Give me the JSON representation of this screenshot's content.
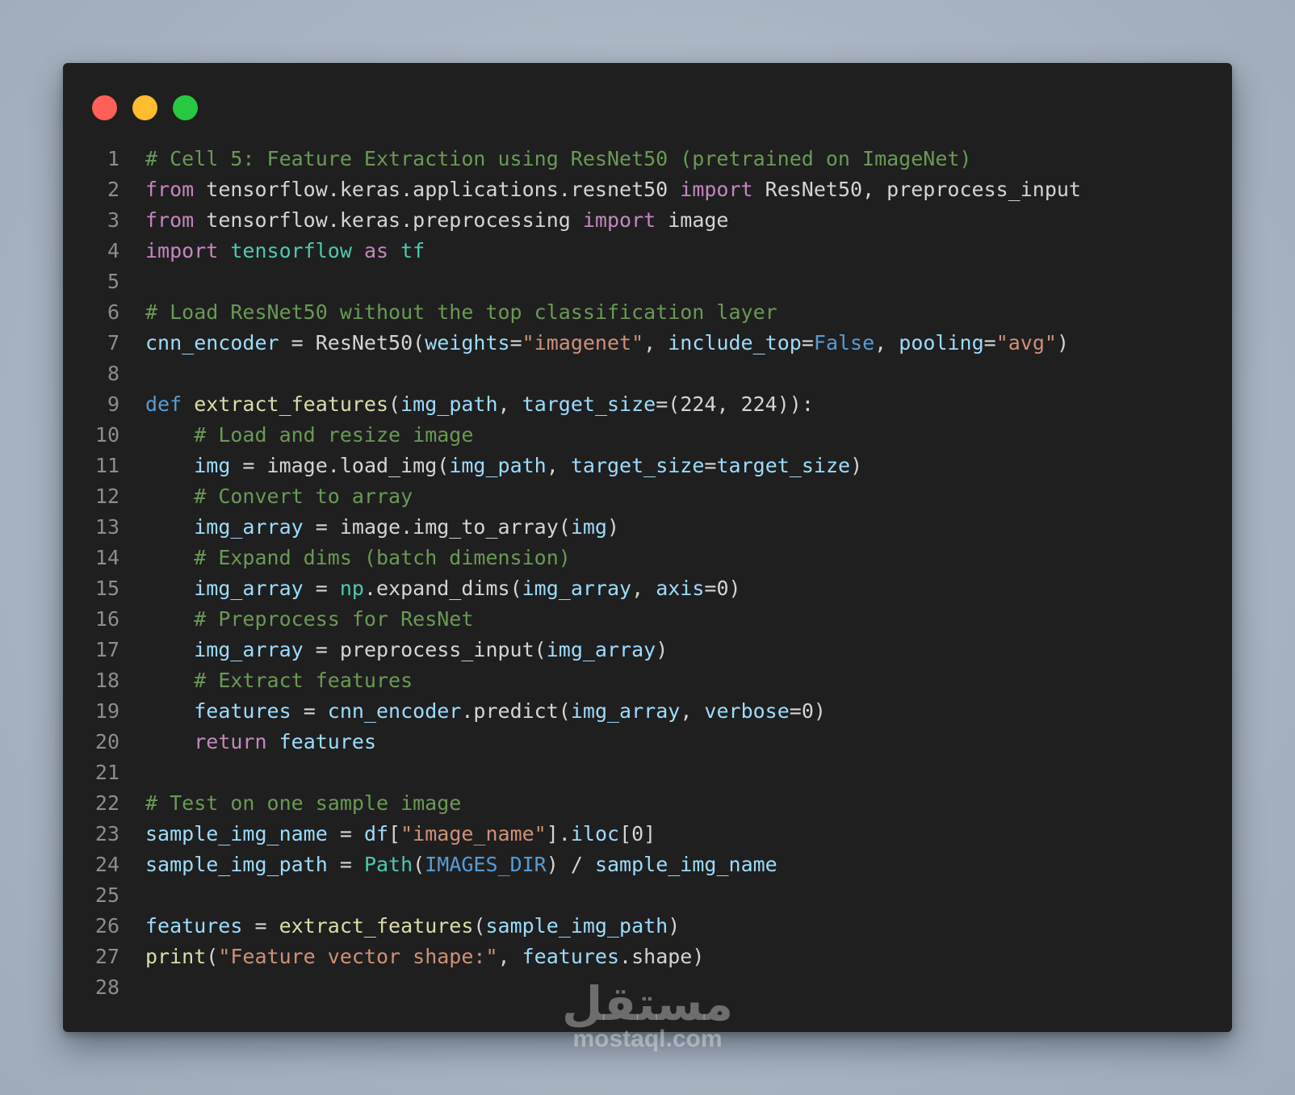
{
  "window": {
    "controls": [
      {
        "name": "close",
        "color": "#fe5f57"
      },
      {
        "name": "minimize",
        "color": "#febc2e"
      },
      {
        "name": "maximize",
        "color": "#28c840"
      }
    ]
  },
  "code": {
    "language": "python",
    "lines": [
      {
        "n": "1",
        "tokens": [
          {
            "t": "# Cell 5: Feature Extraction using ResNet50 (pretrained on ImageNet)",
            "c": "comment"
          }
        ]
      },
      {
        "n": "2",
        "tokens": [
          {
            "t": "from",
            "c": "kw"
          },
          {
            "t": " tensorflow.keras.applications.resnet50 ",
            "c": "plain"
          },
          {
            "t": "import",
            "c": "kw"
          },
          {
            "t": " ResNet50, preprocess_input",
            "c": "plain"
          }
        ]
      },
      {
        "n": "3",
        "tokens": [
          {
            "t": "from",
            "c": "kw"
          },
          {
            "t": " tensorflow.keras.preprocessing ",
            "c": "plain"
          },
          {
            "t": "import",
            "c": "kw"
          },
          {
            "t": " image",
            "c": "plain"
          }
        ]
      },
      {
        "n": "4",
        "tokens": [
          {
            "t": "import",
            "c": "kw"
          },
          {
            "t": " ",
            "c": "plain"
          },
          {
            "t": "tensorflow",
            "c": "mod"
          },
          {
            "t": " ",
            "c": "plain"
          },
          {
            "t": "as",
            "c": "kw"
          },
          {
            "t": " ",
            "c": "plain"
          },
          {
            "t": "tf",
            "c": "mod"
          }
        ]
      },
      {
        "n": "5",
        "tokens": []
      },
      {
        "n": "6",
        "tokens": [
          {
            "t": "# Load ResNet50 without the top classification layer",
            "c": "comment"
          }
        ]
      },
      {
        "n": "7",
        "tokens": [
          {
            "t": "cnn_encoder",
            "c": "var"
          },
          {
            "t": " = ResNet50(",
            "c": "plain"
          },
          {
            "t": "weights",
            "c": "var"
          },
          {
            "t": "=",
            "c": "plain"
          },
          {
            "t": "\"imagenet\"",
            "c": "str"
          },
          {
            "t": ", ",
            "c": "plain"
          },
          {
            "t": "include_top",
            "c": "var"
          },
          {
            "t": "=",
            "c": "plain"
          },
          {
            "t": "False",
            "c": "const"
          },
          {
            "t": ", ",
            "c": "plain"
          },
          {
            "t": "pooling",
            "c": "var"
          },
          {
            "t": "=",
            "c": "plain"
          },
          {
            "t": "\"avg\"",
            "c": "str"
          },
          {
            "t": ")",
            "c": "plain"
          }
        ]
      },
      {
        "n": "8",
        "tokens": []
      },
      {
        "n": "9",
        "tokens": [
          {
            "t": "def",
            "c": "def"
          },
          {
            "t": " ",
            "c": "plain"
          },
          {
            "t": "extract_features",
            "c": "fn"
          },
          {
            "t": "(",
            "c": "plain"
          },
          {
            "t": "img_path",
            "c": "var"
          },
          {
            "t": ", ",
            "c": "plain"
          },
          {
            "t": "target_size",
            "c": "var"
          },
          {
            "t": "=(224, 224)):",
            "c": "plain"
          }
        ]
      },
      {
        "n": "10",
        "tokens": [
          {
            "t": "    ",
            "c": "plain"
          },
          {
            "t": "# Load and resize image",
            "c": "comment"
          }
        ]
      },
      {
        "n": "11",
        "tokens": [
          {
            "t": "    ",
            "c": "plain"
          },
          {
            "t": "img",
            "c": "var"
          },
          {
            "t": " = image.load_img(",
            "c": "plain"
          },
          {
            "t": "img_path",
            "c": "var"
          },
          {
            "t": ", ",
            "c": "plain"
          },
          {
            "t": "target_size",
            "c": "var"
          },
          {
            "t": "=",
            "c": "plain"
          },
          {
            "t": "target_size",
            "c": "var"
          },
          {
            "t": ")",
            "c": "plain"
          }
        ]
      },
      {
        "n": "12",
        "tokens": [
          {
            "t": "    ",
            "c": "plain"
          },
          {
            "t": "# Convert to array",
            "c": "comment"
          }
        ]
      },
      {
        "n": "13",
        "tokens": [
          {
            "t": "    ",
            "c": "plain"
          },
          {
            "t": "img_array",
            "c": "var"
          },
          {
            "t": " = image.img_to_array(",
            "c": "plain"
          },
          {
            "t": "img",
            "c": "var"
          },
          {
            "t": ")",
            "c": "plain"
          }
        ]
      },
      {
        "n": "14",
        "tokens": [
          {
            "t": "    ",
            "c": "plain"
          },
          {
            "t": "# Expand dims (batch dimension)",
            "c": "comment"
          }
        ]
      },
      {
        "n": "15",
        "tokens": [
          {
            "t": "    ",
            "c": "plain"
          },
          {
            "t": "img_array",
            "c": "var"
          },
          {
            "t": " = ",
            "c": "plain"
          },
          {
            "t": "np",
            "c": "mod"
          },
          {
            "t": ".expand_dims(",
            "c": "plain"
          },
          {
            "t": "img_array",
            "c": "var"
          },
          {
            "t": ", ",
            "c": "plain"
          },
          {
            "t": "axis",
            "c": "var"
          },
          {
            "t": "=0)",
            "c": "plain"
          }
        ]
      },
      {
        "n": "16",
        "tokens": [
          {
            "t": "    ",
            "c": "plain"
          },
          {
            "t": "# Preprocess for ResNet",
            "c": "comment"
          }
        ]
      },
      {
        "n": "17",
        "tokens": [
          {
            "t": "    ",
            "c": "plain"
          },
          {
            "t": "img_array",
            "c": "var"
          },
          {
            "t": " = preprocess_input(",
            "c": "plain"
          },
          {
            "t": "img_array",
            "c": "var"
          },
          {
            "t": ")",
            "c": "plain"
          }
        ]
      },
      {
        "n": "18",
        "tokens": [
          {
            "t": "    ",
            "c": "plain"
          },
          {
            "t": "# Extract features",
            "c": "comment"
          }
        ]
      },
      {
        "n": "19",
        "tokens": [
          {
            "t": "    ",
            "c": "plain"
          },
          {
            "t": "features",
            "c": "var"
          },
          {
            "t": " = ",
            "c": "plain"
          },
          {
            "t": "cnn_encoder",
            "c": "var"
          },
          {
            "t": ".predict(",
            "c": "plain"
          },
          {
            "t": "img_array",
            "c": "var"
          },
          {
            "t": ", ",
            "c": "plain"
          },
          {
            "t": "verbose",
            "c": "var"
          },
          {
            "t": "=0)",
            "c": "plain"
          }
        ]
      },
      {
        "n": "20",
        "tokens": [
          {
            "t": "    ",
            "c": "plain"
          },
          {
            "t": "return",
            "c": "kw"
          },
          {
            "t": " ",
            "c": "plain"
          },
          {
            "t": "features",
            "c": "var"
          }
        ]
      },
      {
        "n": "21",
        "tokens": []
      },
      {
        "n": "22",
        "tokens": [
          {
            "t": "# Test on one sample image",
            "c": "comment"
          }
        ]
      },
      {
        "n": "23",
        "tokens": [
          {
            "t": "sample_img_name",
            "c": "var"
          },
          {
            "t": " = ",
            "c": "plain"
          },
          {
            "t": "df",
            "c": "var"
          },
          {
            "t": "[",
            "c": "plain"
          },
          {
            "t": "\"image_name\"",
            "c": "str"
          },
          {
            "t": "].",
            "c": "plain"
          },
          {
            "t": "iloc",
            "c": "var"
          },
          {
            "t": "[0]",
            "c": "plain"
          }
        ]
      },
      {
        "n": "24",
        "tokens": [
          {
            "t": "sample_img_path",
            "c": "var"
          },
          {
            "t": " = ",
            "c": "plain"
          },
          {
            "t": "Path",
            "c": "cls"
          },
          {
            "t": "(",
            "c": "plain"
          },
          {
            "t": "IMAGES_DIR",
            "c": "const"
          },
          {
            "t": ") / ",
            "c": "plain"
          },
          {
            "t": "sample_img_name",
            "c": "var"
          }
        ]
      },
      {
        "n": "25",
        "tokens": []
      },
      {
        "n": "26",
        "tokens": [
          {
            "t": "features",
            "c": "var"
          },
          {
            "t": " = ",
            "c": "plain"
          },
          {
            "t": "extract_features",
            "c": "fn"
          },
          {
            "t": "(",
            "c": "plain"
          },
          {
            "t": "sample_img_path",
            "c": "var"
          },
          {
            "t": ")",
            "c": "plain"
          }
        ]
      },
      {
        "n": "27",
        "tokens": [
          {
            "t": "print",
            "c": "fn"
          },
          {
            "t": "(",
            "c": "plain"
          },
          {
            "t": "\"Feature vector shape:\"",
            "c": "str"
          },
          {
            "t": ", ",
            "c": "plain"
          },
          {
            "t": "features",
            "c": "var"
          },
          {
            "t": ".shape)",
            "c": "plain"
          }
        ]
      },
      {
        "n": "28",
        "tokens": []
      }
    ]
  },
  "watermark": {
    "arabic": "مستقل",
    "latin": "mostaql.com"
  }
}
